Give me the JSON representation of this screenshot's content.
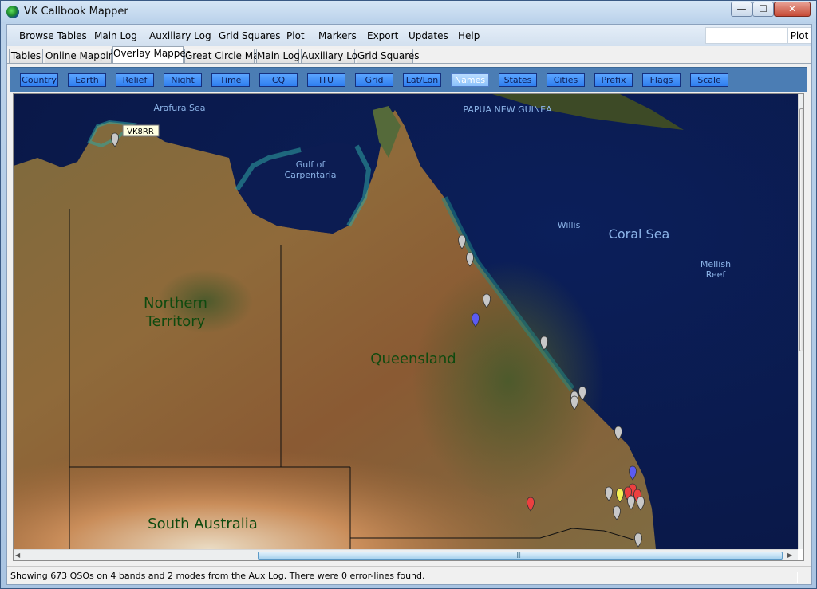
{
  "window": {
    "title": "VK Callbook Mapper",
    "controls": {
      "minimize": "—",
      "maximize": "☐",
      "close": "✕"
    }
  },
  "menubar": {
    "items": [
      "Browse Tables",
      "Main Log",
      "Auxiliary Log",
      "Grid Squares",
      "Plot",
      "Markers",
      "Export",
      "Updates",
      "Help"
    ],
    "plot_input_value": "",
    "plot_button": "Plot"
  },
  "tabs": {
    "items": [
      "Tables",
      "Online Mapping",
      "Overlay Mapper",
      "Great Circle Map",
      "Main Log",
      "Auxiliary Log",
      "Grid Squares"
    ],
    "active": "Overlay Mapper"
  },
  "toolbar": {
    "buttons": [
      "Country",
      "Earth",
      "Relief",
      "Night",
      "Time",
      "CQ",
      "ITU",
      "Grid",
      "Lat/Lon",
      "Names",
      "States",
      "Cities",
      "Prefix",
      "Flags",
      "Scale"
    ]
  },
  "map": {
    "labels": {
      "arafura_sea": "Arafura Sea",
      "papua_new_guinea": "PAPUA NEW GUINEA",
      "gulf_line1": "Gulf of",
      "gulf_line2": "Carpentaria",
      "willis": "Willis",
      "coral_sea": "Coral Sea",
      "mellish_line1": "Mellish",
      "mellish_line2": "Reef",
      "northern_line1": "Northern",
      "northern_line2": "Territory",
      "queensland": "Queensland",
      "south_australia": "South Australia"
    },
    "callsign_tooltip": "VK8RR",
    "marker_colors": {
      "grey": "#c8c8c8",
      "blue": "#5b5bf2",
      "red": "#ec4040",
      "yellow": "#f3f055"
    }
  },
  "status": {
    "text": "Showing 673 QSOs on 4 bands and 2 modes from the Aux Log. There were 0 error-lines found."
  }
}
